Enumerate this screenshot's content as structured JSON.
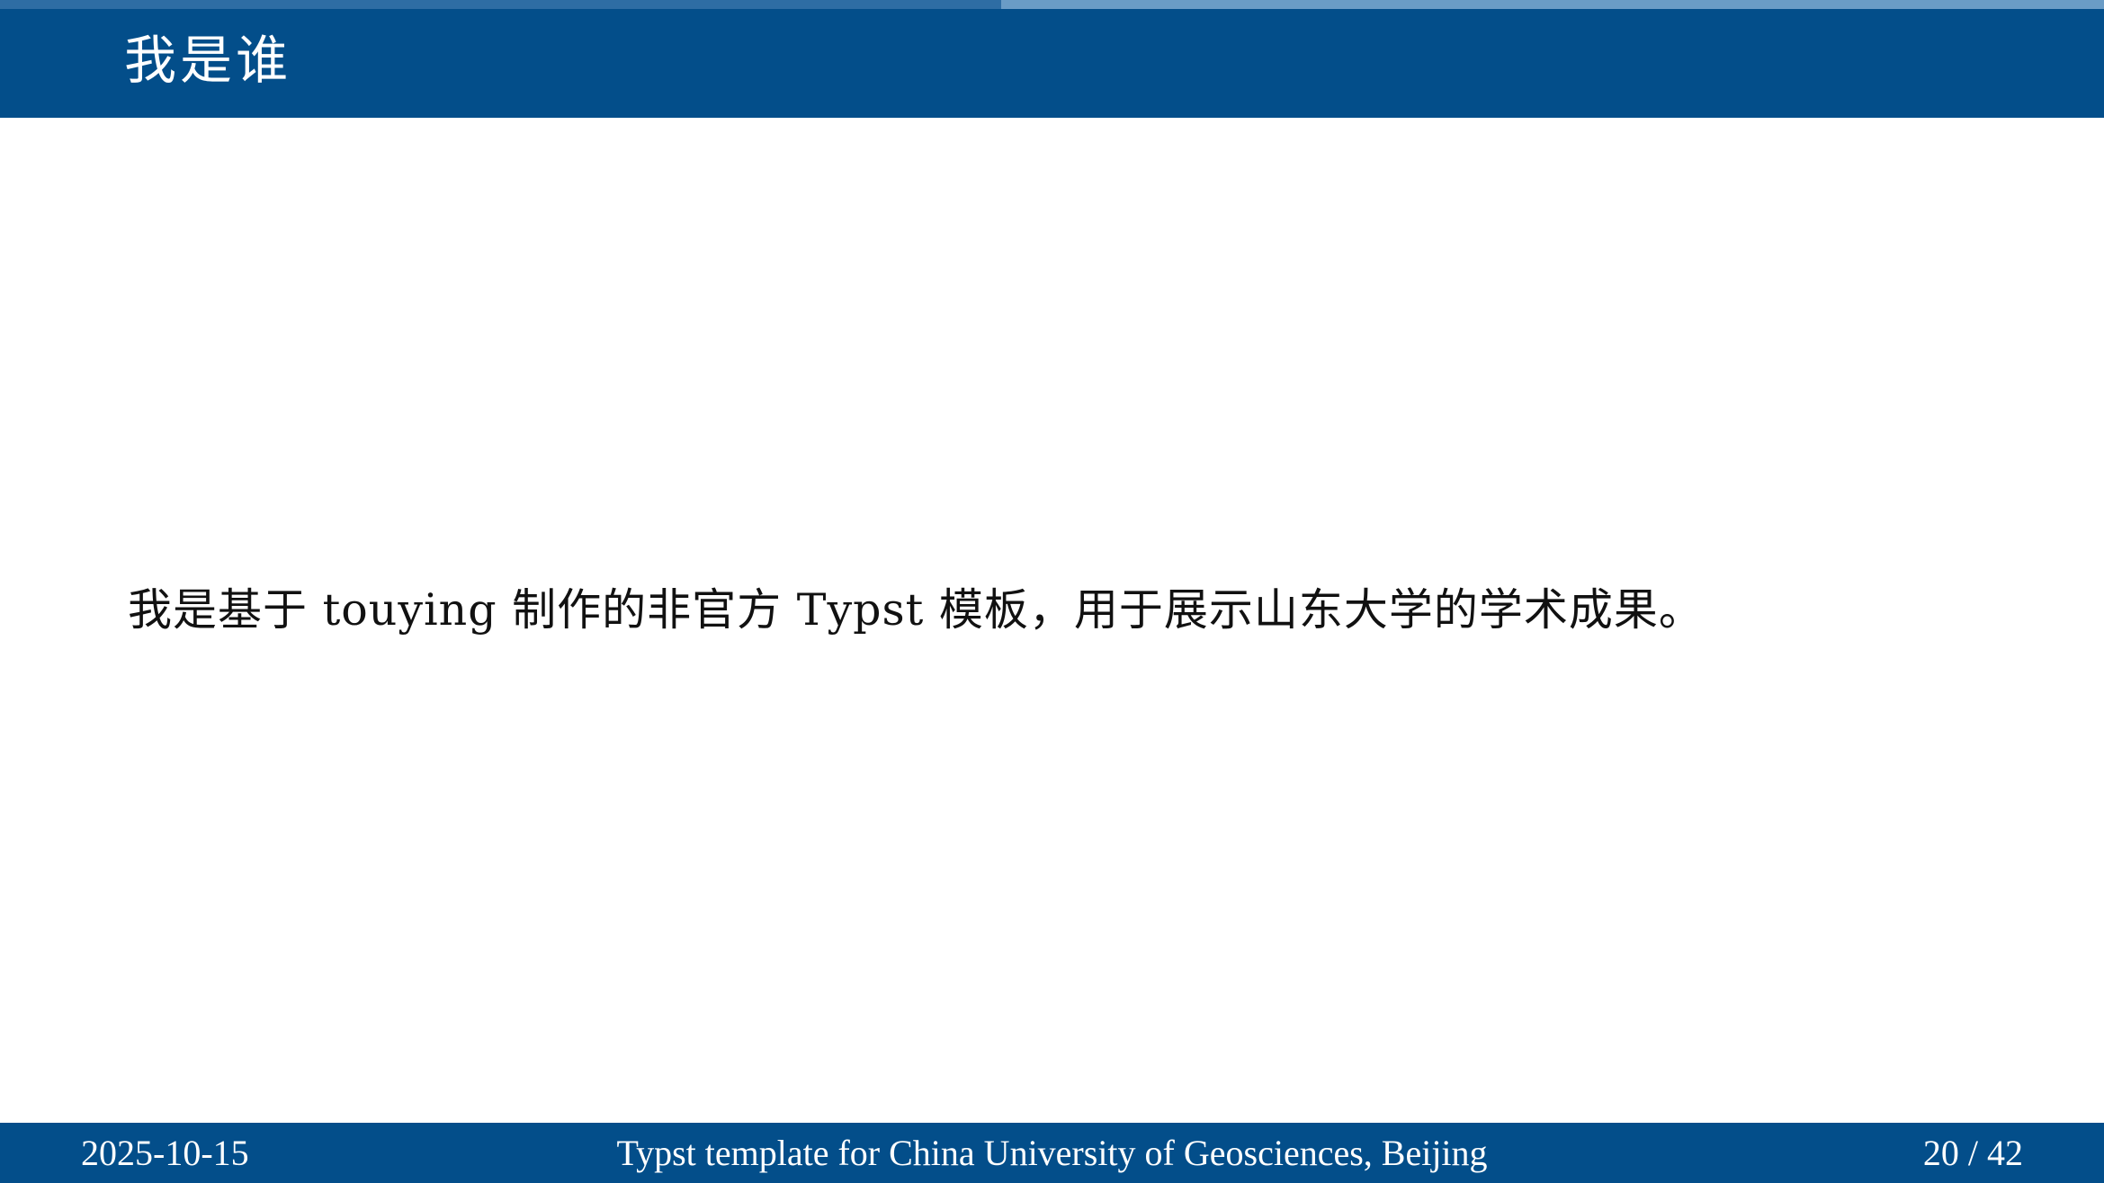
{
  "slide": {
    "title": "我是谁",
    "body": "我是基于 touying 制作的非官方 Typst 模板，用于展示山东大学的学术成果。"
  },
  "progress": {
    "current": 20,
    "total": 42,
    "fraction": 0.476
  },
  "footer": {
    "date": "2025-10-15",
    "title": "Typst template for China University of Geosciences, Beijing",
    "page_label": "20 / 42"
  },
  "colors": {
    "header_bg": "#034e8a",
    "progress_fill": "#2e6da4",
    "progress_track": "#6a9cc6",
    "text": "#111111"
  }
}
